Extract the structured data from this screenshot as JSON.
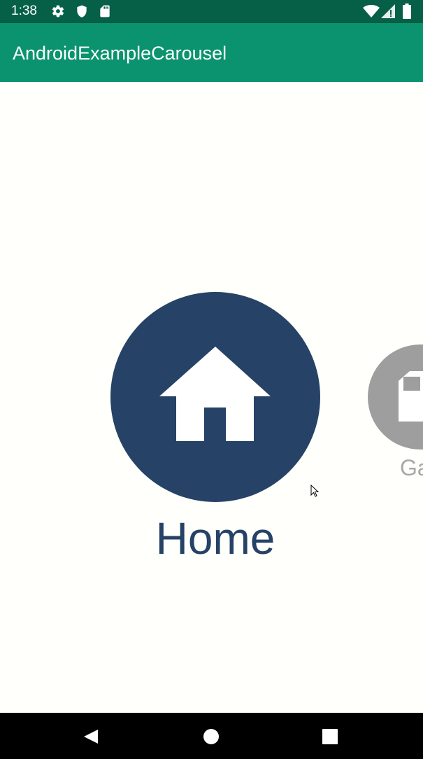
{
  "status_bar": {
    "time": "1:38",
    "icons": [
      "settings-icon",
      "shield-icon",
      "sd-card-icon",
      "wifi-icon",
      "signal-icon",
      "battery-icon"
    ]
  },
  "app_bar": {
    "title": "AndroidExampleCarousel",
    "color": "#0a936e",
    "status_color": "#066048"
  },
  "carousel": {
    "selected": {
      "label": "Home",
      "icon": "home-icon",
      "color": "#264266"
    },
    "next": {
      "label": "Ga",
      "icon": "sd-card-icon",
      "color": "#9e9e9e"
    }
  },
  "nav_bar": {
    "buttons": [
      "back-icon",
      "home-nav-icon",
      "recents-icon"
    ]
  }
}
